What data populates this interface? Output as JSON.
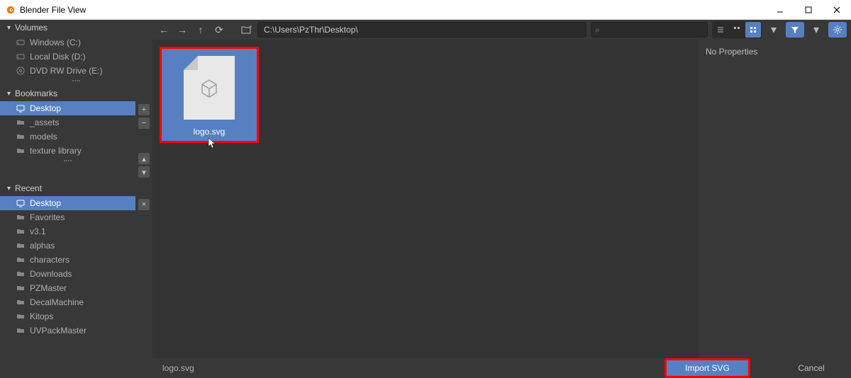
{
  "window": {
    "title": "Blender File View"
  },
  "toolbar": {
    "path": "C:\\Users\\PzThr\\Desktop\\"
  },
  "sidebar": {
    "volumes": {
      "header": "Volumes",
      "items": [
        {
          "label": "Windows (C:)",
          "icon": "drive"
        },
        {
          "label": "Local Disk (D:)",
          "icon": "drive"
        },
        {
          "label": "DVD RW Drive (E:)",
          "icon": "disc"
        }
      ]
    },
    "bookmarks": {
      "header": "Bookmarks",
      "items": [
        {
          "label": "Desktop",
          "icon": "desktop",
          "selected": true
        },
        {
          "label": "_assets",
          "icon": "folder"
        },
        {
          "label": "models",
          "icon": "folder"
        },
        {
          "label": "texture library",
          "icon": "folder"
        }
      ]
    },
    "recent": {
      "header": "Recent",
      "items": [
        {
          "label": "Desktop",
          "icon": "desktop",
          "selected": true
        },
        {
          "label": "Favorites",
          "icon": "folder"
        },
        {
          "label": "v3.1",
          "icon": "folder"
        },
        {
          "label": "alphas",
          "icon": "folder"
        },
        {
          "label": "characters",
          "icon": "folder"
        },
        {
          "label": "Downloads",
          "icon": "folder"
        },
        {
          "label": "PZMaster",
          "icon": "folder"
        },
        {
          "label": "DecalMachine",
          "icon": "folder"
        },
        {
          "label": "Kitops",
          "icon": "folder"
        },
        {
          "label": "UVPackMaster",
          "icon": "folder"
        }
      ]
    }
  },
  "files": {
    "selected": {
      "name": "logo.svg"
    }
  },
  "properties": {
    "empty": "No Properties"
  },
  "bottom": {
    "filename": "logo.svg",
    "import_label": "Import SVG",
    "cancel_label": "Cancel"
  }
}
